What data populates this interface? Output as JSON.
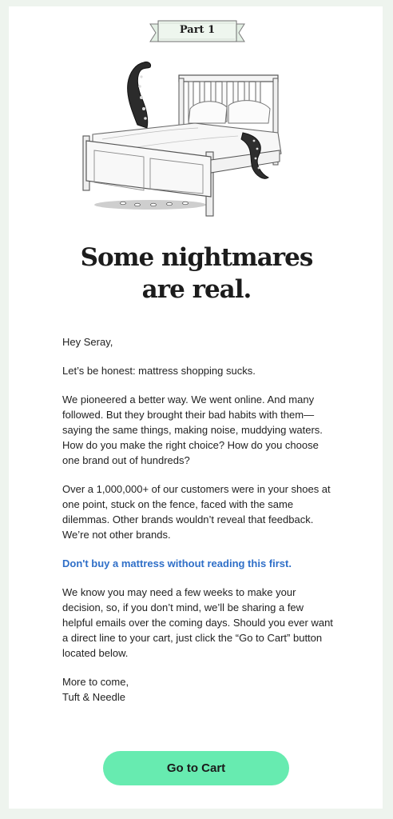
{
  "banner": {
    "label": "Part 1"
  },
  "illustration": {
    "icon": "bed-with-tentacle-icon"
  },
  "headline": {
    "line1": "Some nightmares",
    "line2": "are real."
  },
  "email": {
    "greeting": "Hey Seray,",
    "para1": "Let’s be honest: mattress shopping sucks.",
    "para2": "We pioneered a better way. We went online. And many followed. But they brought their bad habits with them—saying the same things, making noise, muddying waters. How do you make the right choice? How do you choose one brand out of hundreds?",
    "para3": "Over a 1,000,000+ of our customers were in your shoes at one point, stuck on the fence, faced with the same dilemmas. Other brands wouldn’t reveal that feedback. We’re not other brands.",
    "link": "Don't buy a mattress without reading this first.",
    "para4": "We know you may need a few weeks to make your decision, so, if you don’t mind, we’ll be sharing a few helpful emails over the coming days. Should you ever want a direct line to your cart, just click the “Go to Cart” button located below.",
    "signoff1": "More to come,",
    "signoff2": "Tuft & Needle"
  },
  "cta": {
    "label": "Go to Cart"
  },
  "colors": {
    "background": "#eef4ee",
    "card": "#ffffff",
    "link": "#2f6fc8",
    "cta": "#67ebb0",
    "text": "#222222"
  }
}
